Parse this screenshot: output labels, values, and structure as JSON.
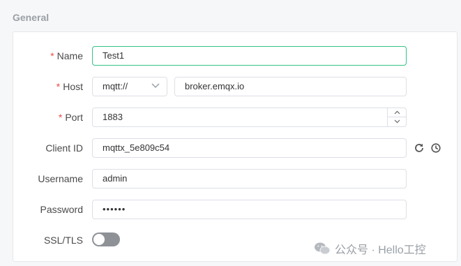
{
  "section": {
    "title": "General"
  },
  "form": {
    "name": {
      "label": "Name",
      "required_mark": "*",
      "value": "Test1"
    },
    "host": {
      "label": "Host",
      "required_mark": "*",
      "protocol": "mqtt://",
      "value": "broker.emqx.io"
    },
    "port": {
      "label": "Port",
      "required_mark": "*",
      "value": "1883"
    },
    "client_id": {
      "label": "Client ID",
      "value": "mqttx_5e809c54"
    },
    "username": {
      "label": "Username",
      "value": "admin"
    },
    "password": {
      "label": "Password",
      "value": "••••••"
    },
    "ssl": {
      "label": "SSL/TLS",
      "enabled": false
    }
  },
  "watermark": {
    "text": "公众号 · Hello工控"
  },
  "colors": {
    "accent": "#34c388",
    "required": "#ef4a4a",
    "toggle_off": "#8e9297",
    "border": "#dcdfe6"
  },
  "icons": {
    "protocol_dropdown": "chevron-down-icon",
    "port_increment": "chevron-up-icon",
    "port_decrement": "chevron-down-icon",
    "refresh": "refresh-icon",
    "history": "clock-icon",
    "watermark": "wechat-icon"
  }
}
